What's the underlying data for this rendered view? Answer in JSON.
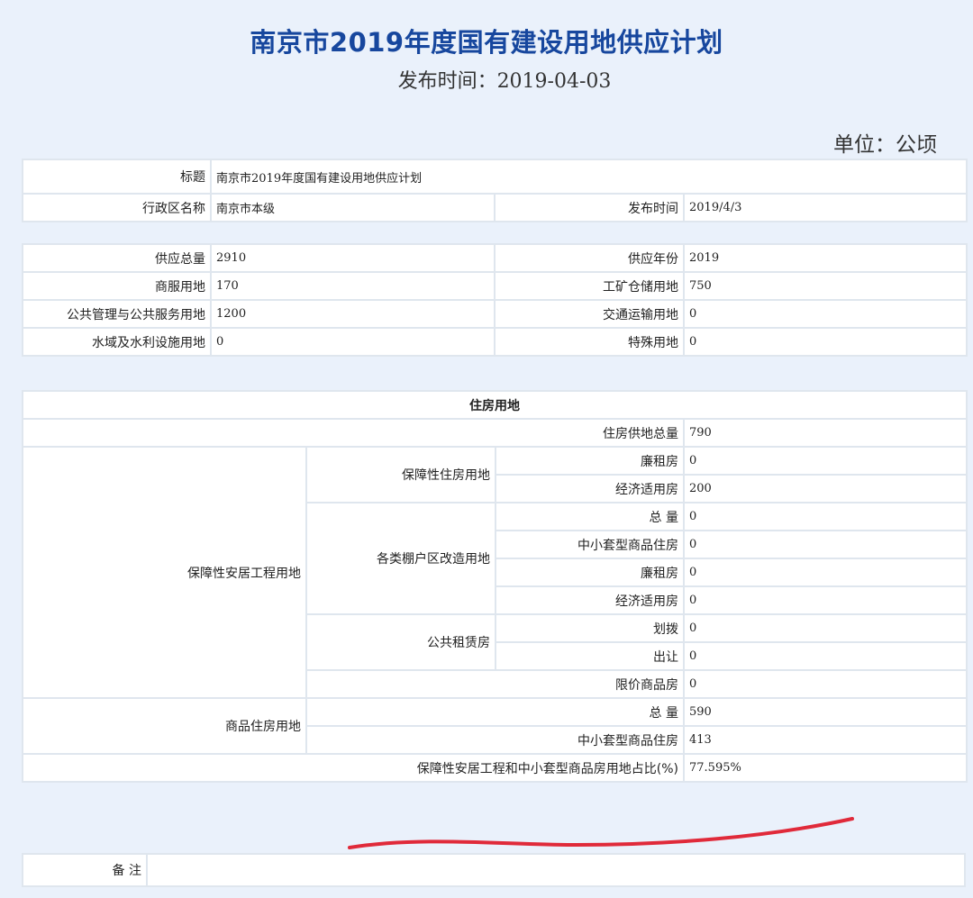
{
  "header": {
    "title": "南京市2019年度国有建设用地供应计划",
    "publish_line": "发布时间：2019-04-03",
    "unit": "单位：公顷"
  },
  "info": {
    "title_label": "标题",
    "title_value": "南京市2019年度国有建设用地供应计划",
    "region_label": "行政区名称",
    "region_value": "南京市本级",
    "date_label": "发布时间",
    "date_value": "2019/4/3"
  },
  "supply": {
    "total_label": "供应总量",
    "total_value": "2910",
    "year_label": "供应年份",
    "year_value": "2019",
    "commercial_label": "商服用地",
    "commercial_value": "170",
    "industrial_label": "工矿仓储用地",
    "industrial_value": "750",
    "public_label": "公共管理与公共服务用地",
    "public_value": "1200",
    "transport_label": "交通运输用地",
    "transport_value": "0",
    "water_label": "水域及水利设施用地",
    "water_value": "0",
    "special_label": "特殊用地",
    "special_value": "0"
  },
  "housing": {
    "heading": "住房用地",
    "total_label": "住房供地总量",
    "total_value": "790",
    "anju_label": "保障性安居工程用地",
    "baozhang_label": "保障性住房用地",
    "lianzu_label": "廉租房",
    "lianzu_value": "0",
    "jingji_label": "经济适用房",
    "jingji_value": "200",
    "penghu_label": "各类棚户区改造用地",
    "penghu_total_label": "总 量",
    "penghu_total_value": "0",
    "penghu_small_label": "中小套型商品住房",
    "penghu_small_value": "0",
    "penghu_lianzu_label": "廉租房",
    "penghu_lianzu_value": "0",
    "penghu_jingji_label": "经济适用房",
    "penghu_jingji_value": "0",
    "zulin_label": "公共租赁房",
    "huabo_label": "划拨",
    "huabo_value": "0",
    "churang_label": "出让",
    "churang_value": "0",
    "xianjia_label": "限价商品房",
    "xianjia_value": "0",
    "shangpin_label": "商品住房用地",
    "shangpin_total_label": "总 量",
    "shangpin_total_value": "590",
    "shangpin_small_label": "中小套型商品住房",
    "shangpin_small_value": "413",
    "ratio_label": "保障性安居工程和中小套型商品房用地占比(%)",
    "ratio_value": "77.595%"
  },
  "remark": {
    "label": "备 注",
    "value": ""
  },
  "annotation": {
    "underline_color": "#e02a3a"
  }
}
